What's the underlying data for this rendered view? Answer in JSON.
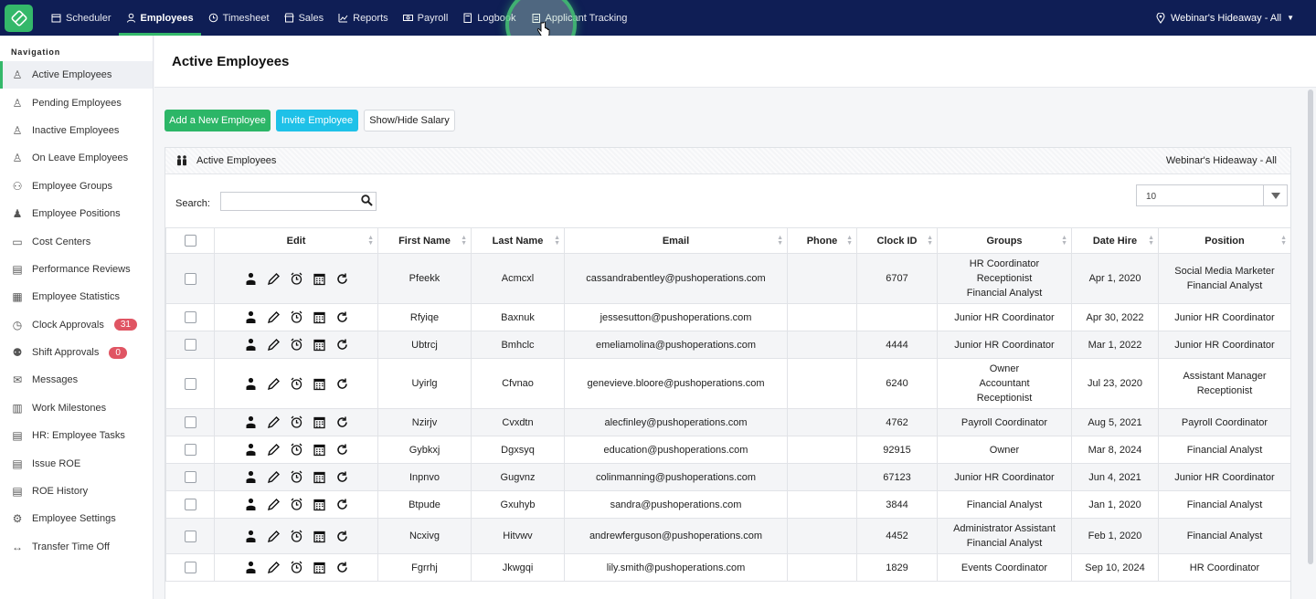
{
  "topnav": {
    "items": [
      {
        "label": "Scheduler",
        "icon": "calendar-icon"
      },
      {
        "label": "Employees",
        "icon": "user-icon",
        "active": true
      },
      {
        "label": "Timesheet",
        "icon": "clock-icon"
      },
      {
        "label": "Sales",
        "icon": "shop-icon"
      },
      {
        "label": "Reports",
        "icon": "chart-icon"
      },
      {
        "label": "Payroll",
        "icon": "money-icon"
      },
      {
        "label": "Logbook",
        "icon": "book-icon"
      },
      {
        "label": "Applicant Tracking",
        "icon": "clipboard-icon"
      }
    ],
    "location": "Webinar's Hideaway - All",
    "accent": "#34b86a",
    "bg": "#0f1e55"
  },
  "sidebar": {
    "heading": "Navigation",
    "items": [
      {
        "label": "Active Employees",
        "icon": "person-icon",
        "active": true
      },
      {
        "label": "Pending Employees",
        "icon": "person-clock-icon"
      },
      {
        "label": "Inactive Employees",
        "icon": "person-x-icon"
      },
      {
        "label": "On Leave Employees",
        "icon": "person-leave-icon"
      },
      {
        "label": "Employee Groups",
        "icon": "group-icon"
      },
      {
        "label": "Employee Positions",
        "icon": "position-icon"
      },
      {
        "label": "Cost Centers",
        "icon": "box-icon"
      },
      {
        "label": "Performance Reviews",
        "icon": "document-icon"
      },
      {
        "label": "Employee Statistics",
        "icon": "stats-icon"
      },
      {
        "label": "Clock Approvals",
        "icon": "clock-icon",
        "badge": "31"
      },
      {
        "label": "Shift Approvals",
        "icon": "shift-icon",
        "badge": "0"
      },
      {
        "label": "Messages",
        "icon": "mail-icon"
      },
      {
        "label": "Work Milestones",
        "icon": "milestone-icon"
      },
      {
        "label": "HR: Employee Tasks",
        "icon": "tasks-icon"
      },
      {
        "label": "Issue ROE",
        "icon": "issue-icon"
      },
      {
        "label": "ROE History",
        "icon": "history-icon"
      },
      {
        "label": "Employee Settings",
        "icon": "settings-icon"
      },
      {
        "label": "Transfer Time Off",
        "icon": "transfer-icon"
      }
    ]
  },
  "page": {
    "title": "Active Employees",
    "buttons": {
      "add": "Add a New Employee",
      "invite": "Invite Employee",
      "salary": "Show/Hide Salary"
    },
    "panel_title": "Active Employees",
    "panel_location": "Webinar's Hideaway - All",
    "search_label": "Search:",
    "page_size": "10"
  },
  "table": {
    "columns": [
      "Edit",
      "First Name",
      "Last Name",
      "Email",
      "Phone",
      "Clock ID",
      "Groups",
      "Date Hire",
      "Position"
    ],
    "rows": [
      {
        "first": "Pfeekk",
        "last": "Acmcxl",
        "email": "cassandrabentley@pushoperations.com",
        "phone": "",
        "clock": "6707",
        "groups": [
          "HR Coordinator",
          "Receptionist",
          "Financial Analyst"
        ],
        "hire": "Apr 1, 2020",
        "position": [
          "Social Media Marketer",
          "Financial Analyst"
        ]
      },
      {
        "first": "Rfyiqe",
        "last": "Baxnuk",
        "email": "jessesutton@pushoperations.com",
        "phone": "",
        "clock": "",
        "groups": [
          "Junior HR Coordinator"
        ],
        "hire": "Apr 30, 2022",
        "position": [
          "Junior HR Coordinator"
        ]
      },
      {
        "first": "Ubtrcj",
        "last": "Bmhclc",
        "email": "emeliamolina@pushoperations.com",
        "phone": "",
        "clock": "4444",
        "groups": [
          "Junior HR Coordinator"
        ],
        "hire": "Mar 1, 2022",
        "position": [
          "Junior HR Coordinator"
        ]
      },
      {
        "first": "Uyirlg",
        "last": "Cfvnao",
        "email": "genevieve.bloore@pushoperations.com",
        "phone": "",
        "clock": "6240",
        "groups": [
          "Owner",
          "Accountant",
          "Receptionist"
        ],
        "hire": "Jul 23, 2020",
        "position": [
          "Assistant Manager",
          "Receptionist"
        ]
      },
      {
        "first": "Nzirjv",
        "last": "Cvxdtn",
        "email": "alecfinley@pushoperations.com",
        "phone": "",
        "clock": "4762",
        "groups": [
          "Payroll Coordinator"
        ],
        "hire": "Aug 5, 2021",
        "position": [
          "Payroll Coordinator"
        ]
      },
      {
        "first": "Gybkxj",
        "last": "Dgxsyq",
        "email": "education@pushoperations.com",
        "phone": "",
        "clock": "92915",
        "groups": [
          "Owner"
        ],
        "hire": "Mar 8, 2024",
        "position": [
          "Financial Analyst"
        ]
      },
      {
        "first": "Inpnvo",
        "last": "Gugvnz",
        "email": "colinmanning@pushoperations.com",
        "phone": "",
        "clock": "67123",
        "groups": [
          "Junior HR Coordinator"
        ],
        "hire": "Jun 4, 2021",
        "position": [
          "Junior HR Coordinator"
        ]
      },
      {
        "first": "Btpude",
        "last": "Gxuhyb",
        "email": "sandra@pushoperations.com",
        "phone": "",
        "clock": "3844",
        "groups": [
          "Financial Analyst"
        ],
        "hire": "Jan 1, 2020",
        "position": [
          "Financial Analyst"
        ]
      },
      {
        "first": "Ncxivg",
        "last": "Hitvwv",
        "email": "andrewferguson@pushoperations.com",
        "phone": "",
        "clock": "4452",
        "groups": [
          "Administrator Assistant",
          "Financial Analyst"
        ],
        "hire": "Feb 1, 2020",
        "position": [
          "Financial Analyst"
        ]
      },
      {
        "first": "Fgrrhj",
        "last": "Jkwgqi",
        "email": "lily.smith@pushoperations.com",
        "phone": "",
        "clock": "1829",
        "groups": [
          "Events Coordinator"
        ],
        "hire": "Sep 10, 2024",
        "position": [
          "HR Coordinator"
        ]
      }
    ]
  }
}
